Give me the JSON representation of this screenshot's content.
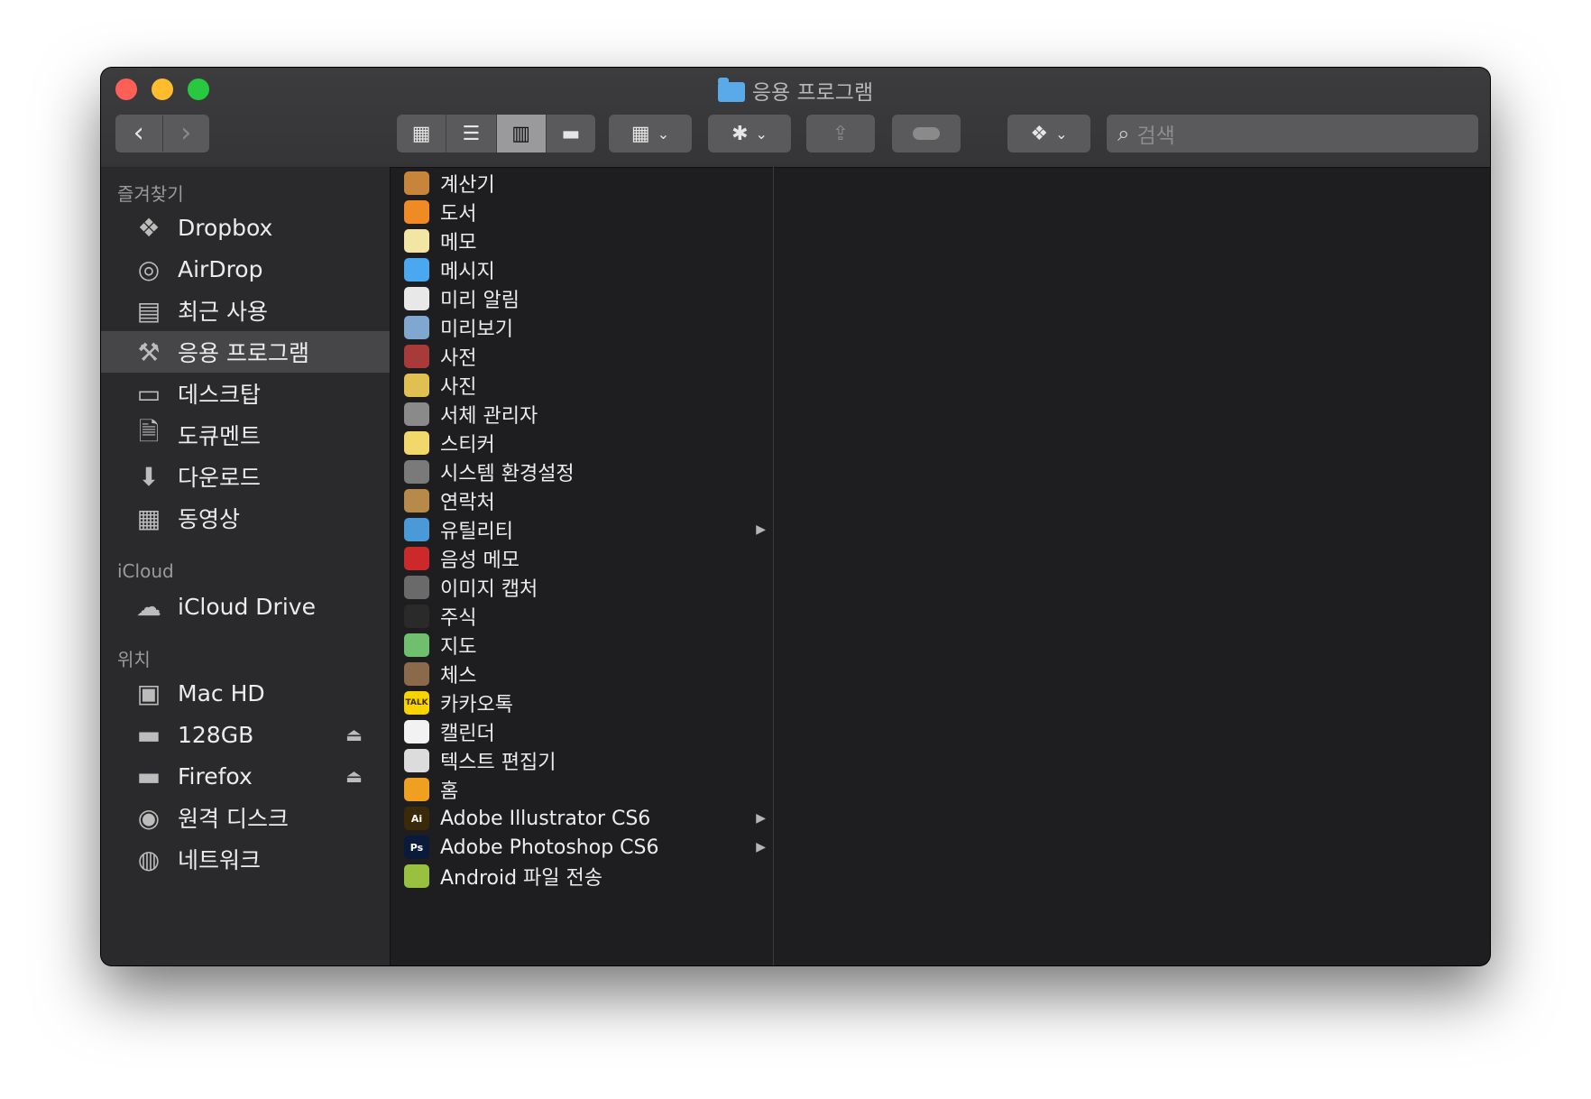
{
  "window": {
    "title": "응용 프로그램"
  },
  "toolbar": {
    "back_label": "‹",
    "forward_label": "›",
    "view_icons": [
      "▦",
      "☰",
      "▥",
      "▬"
    ],
    "group_label": "▦",
    "action_label": "✱",
    "share_label": "⇪",
    "dropbox_label": "❖",
    "search_placeholder": "검색",
    "search_icon": "⌕",
    "chevron": "⌄"
  },
  "sidebar": {
    "favorites_title": "즐겨찾기",
    "favorites": [
      {
        "label": "Dropbox",
        "icon": "dropbox-icon",
        "glyph": "❖"
      },
      {
        "label": "AirDrop",
        "icon": "airdrop-icon",
        "glyph": "◎"
      },
      {
        "label": "최근 사용",
        "icon": "recents-icon",
        "glyph": "▤"
      },
      {
        "label": "응용 프로그램",
        "icon": "applications-icon",
        "glyph": "⚒"
      },
      {
        "label": "데스크탑",
        "icon": "desktop-icon",
        "glyph": "▭"
      },
      {
        "label": "도큐멘트",
        "icon": "documents-icon",
        "glyph": "🗎"
      },
      {
        "label": "다운로드",
        "icon": "downloads-icon",
        "glyph": "⬇"
      },
      {
        "label": "동영상",
        "icon": "movies-icon",
        "glyph": "▦"
      }
    ],
    "icloud_title": "iCloud",
    "icloud": [
      {
        "label": "iCloud Drive",
        "icon": "cloud-icon",
        "glyph": "☁"
      }
    ],
    "locations_title": "위치",
    "locations": [
      {
        "label": "Mac HD",
        "icon": "hard-drive-icon",
        "glyph": "▣"
      },
      {
        "label": "128GB",
        "icon": "external-drive-icon",
        "glyph": "▬"
      },
      {
        "label": "Firefox",
        "icon": "external-drive-icon",
        "glyph": "▬"
      },
      {
        "label": "원격 디스크",
        "icon": "remote-disc-icon",
        "glyph": "◉"
      },
      {
        "label": "네트워크",
        "icon": "network-icon",
        "glyph": "◍"
      }
    ],
    "eject_glyph": "⏏"
  },
  "applications": [
    {
      "label": "계산기",
      "color": "#c8843a"
    },
    {
      "label": "도서",
      "color": "#f08a24"
    },
    {
      "label": "메모",
      "color": "#f3e6a5"
    },
    {
      "label": "메시지",
      "color": "#4aa8f0"
    },
    {
      "label": "미리 알림",
      "color": "#e8e8e8"
    },
    {
      "label": "미리보기",
      "color": "#7fa7cf"
    },
    {
      "label": "사전",
      "color": "#a83a3a"
    },
    {
      "label": "사진",
      "color": "#e0c050"
    },
    {
      "label": "서체 관리자",
      "color": "#8a8a8a"
    },
    {
      "label": "스티커",
      "color": "#f2d76a"
    },
    {
      "label": "시스템 환경설정",
      "color": "#7a7a7a"
    },
    {
      "label": "연락처",
      "color": "#b88a4a"
    },
    {
      "label": "유틸리티",
      "color": "#4a9ad8"
    },
    {
      "label": "음성 메모",
      "color": "#cc2a2a"
    },
    {
      "label": "이미지 캡처",
      "color": "#6a6a6a"
    },
    {
      "label": "주식",
      "color": "#2a2a2a"
    },
    {
      "label": "지도",
      "color": "#6fbf6f"
    },
    {
      "label": "체스",
      "color": "#8a6a4a"
    },
    {
      "label": "카카오톡",
      "color": "#f7d400"
    },
    {
      "label": "캘린더",
      "color": "#f2f2f2"
    },
    {
      "label": "텍스트 편집기",
      "color": "#dcdcdc"
    },
    {
      "label": "홈",
      "color": "#f0a020"
    },
    {
      "label": "Adobe Illustrator CS6",
      "color": "#3a2a0a"
    },
    {
      "label": "Adobe Photoshop CS6",
      "color": "#0a1a3a"
    },
    {
      "label": "Android 파일 전송",
      "color": "#9ac040"
    }
  ],
  "app_icon_text": {
    "카카오톡": "TALK",
    "Adobe Illustrator CS6": "Ai",
    "Adobe Photoshop CS6": "Ps"
  },
  "folders_with_arrow": [
    "유틸리티",
    "Adobe Illustrator CS6",
    "Adobe Photoshop CS6"
  ],
  "arrow_glyph": "▶"
}
